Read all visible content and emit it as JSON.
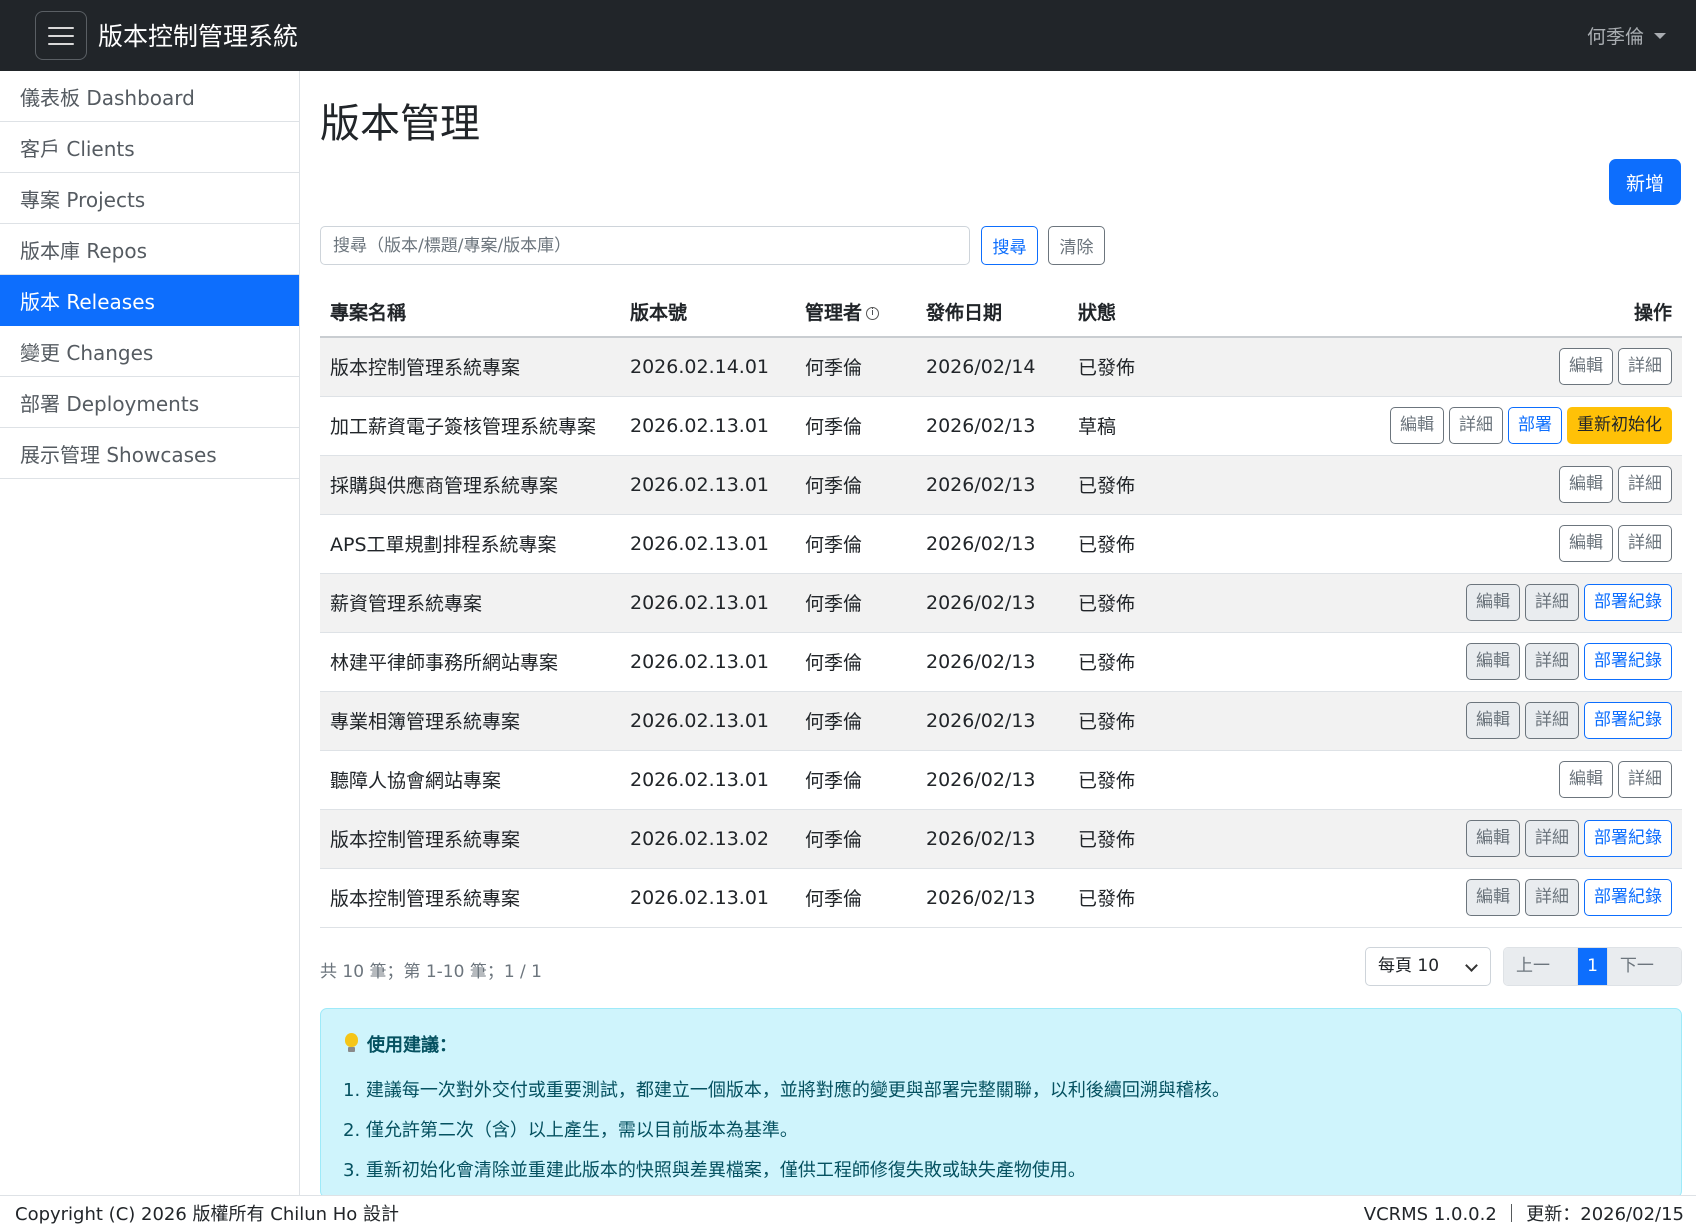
{
  "app": {
    "title": "版本控制管理系統",
    "user": "何季倫"
  },
  "sidebar": {
    "items": [
      {
        "label": "儀表板 Dashboard"
      },
      {
        "label": "客戶 Clients"
      },
      {
        "label": "專案 Projects"
      },
      {
        "label": "版本庫 Repos"
      },
      {
        "label": "版本 Releases",
        "active": true
      },
      {
        "label": "變更 Changes"
      },
      {
        "label": "部署 Deployments"
      },
      {
        "label": "展示管理 Showcases"
      }
    ]
  },
  "page": {
    "title": "版本管理",
    "new_label": "新增"
  },
  "search": {
    "placeholder": "搜尋（版本/標題/專案/版本庫）",
    "search_label": "搜尋",
    "clear_label": "清除"
  },
  "table": {
    "headers": [
      "專案名稱",
      "版本號",
      "管理者",
      "發佈日期",
      "狀態",
      "操作"
    ],
    "buttons": {
      "edit": "編輯",
      "detail": "詳細",
      "deploy": "部署",
      "reinit": "重新初始化",
      "deploy_log": "部署紀錄"
    },
    "rows": [
      {
        "project": "版本控制管理系統專案",
        "version": "2026.02.14.01",
        "manager": "何季倫",
        "date": "2026/02/14",
        "status": "已發佈"
      },
      {
        "project": "加工薪資電子簽核管理系統專案",
        "version": "2026.02.13.01",
        "manager": "何季倫",
        "date": "2026/02/13",
        "status": "草稿"
      },
      {
        "project": "採購與供應商管理系統專案",
        "version": "2026.02.13.01",
        "manager": "何季倫",
        "date": "2026/02/13",
        "status": "已發佈"
      },
      {
        "project": "APS工單規劃排程系統專案",
        "version": "2026.02.13.01",
        "manager": "何季倫",
        "date": "2026/02/13",
        "status": "已發佈"
      },
      {
        "project": "薪資管理系統專案",
        "version": "2026.02.13.01",
        "manager": "何季倫",
        "date": "2026/02/13",
        "status": "已發佈"
      },
      {
        "project": "林建平律師事務所網站專案",
        "version": "2026.02.13.01",
        "manager": "何季倫",
        "date": "2026/02/13",
        "status": "已發佈"
      },
      {
        "project": "專業相簿管理系統專案",
        "version": "2026.02.13.01",
        "manager": "何季倫",
        "date": "2026/02/13",
        "status": "已發佈"
      },
      {
        "project": "聽障人協會網站專案",
        "version": "2026.02.13.01",
        "manager": "何季倫",
        "date": "2026/02/13",
        "status": "已發佈"
      },
      {
        "project": "版本控制管理系統專案",
        "version": "2026.02.13.02",
        "manager": "何季倫",
        "date": "2026/02/13",
        "status": "已發佈"
      },
      {
        "project": "版本控制管理系統專案",
        "version": "2026.02.13.01",
        "manager": "何季倫",
        "date": "2026/02/13",
        "status": "已發佈"
      }
    ]
  },
  "pagination": {
    "summary": "共 10 筆；第 1-10 筆；1 / 1",
    "per_page": "每頁 10",
    "prev": "上一頁",
    "current": "1",
    "next": "下一頁"
  },
  "tips": {
    "title": "使用建議：",
    "lines": [
      "1. 建議每一次對外交付或重要測試，都建立一個版本，並將對應的變更與部署完整關聯，以利後續回溯與稽核。",
      "2. 僅允許第二次（含）以上產生，需以目前版本為基準。",
      "3. 重新初始化會清除並重建此版本的快照與差異檔案，僅供工程師修復失敗或缺失產物使用。"
    ]
  },
  "footer": {
    "copyright": "Copyright (C) 2026 版權所有 Chilun Ho 設計",
    "version": "VCRMS 1.0.0.2 ｜ 更新：2026/02/15"
  }
}
